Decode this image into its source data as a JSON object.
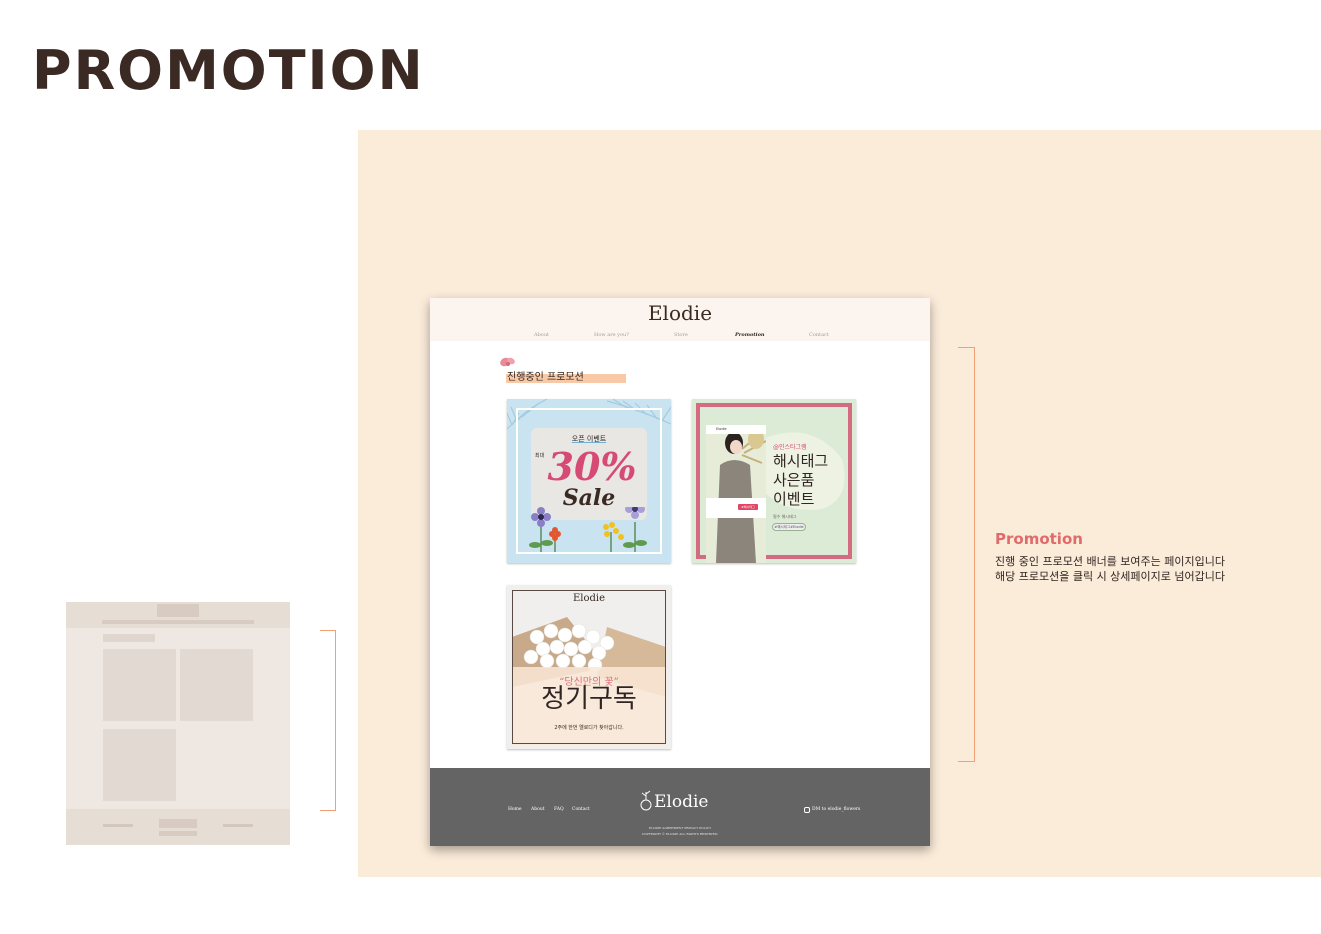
{
  "page": {
    "heading": "PROMOTION"
  },
  "site": {
    "logo": "Elodie",
    "nav": [
      {
        "label": "About",
        "active": false
      },
      {
        "label": "How are you?",
        "active": false
      },
      {
        "label": "Store",
        "active": false
      },
      {
        "label": "Promotion",
        "active": true
      },
      {
        "label": "Contact",
        "active": false
      }
    ],
    "section_title": "진행중인 프로모션",
    "banners": {
      "open_event": {
        "event": "오픈 이벤트",
        "max": "최대",
        "discount": "30%",
        "sale": "Sale"
      },
      "hashtag_event": {
        "tag": "@인스타그램",
        "line1": "해시태그",
        "line2": "사은품",
        "line3": "이벤트",
        "note": "필수 해시태그",
        "pill": "#해시태그#Elodie",
        "ig_user": "Elodie",
        "ig_tag": "#해시태그#Elodie"
      },
      "subscription": {
        "logo": "Elodie",
        "quote": "“당신만의 꽃”",
        "title": "정기구독",
        "subtitle": "2주에 한번 엘로디가 찾아갑니다."
      }
    },
    "footer": {
      "links": [
        "Home",
        "About",
        "FAQ",
        "Contact"
      ],
      "logo": "Elodie",
      "dm": "DM to elodie_flowers",
      "policy": "ELODIE AGREEMENT   PRIVACY POLICY",
      "copyright": "COPYRIGHT © ELODIE ALL RIGHTS RESERVED."
    }
  },
  "description": {
    "title": "Promotion",
    "lines": [
      "진행 중인 프로모션 배너를 보여주는 페이지입니다",
      "해당 프로모션을 클릭 시 상세페이지로 넘어갑니다"
    ]
  },
  "colors": {
    "panel": "#fbebd9",
    "accent": "#e06b6b",
    "footer": "#646464",
    "bracket": "#f1a173"
  }
}
